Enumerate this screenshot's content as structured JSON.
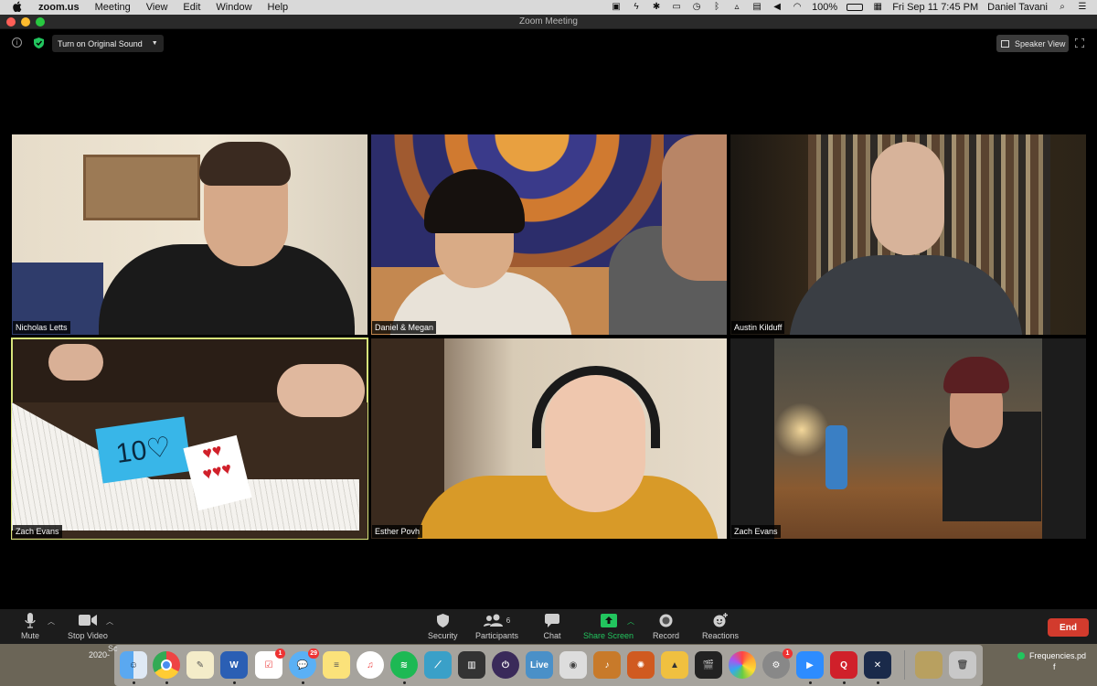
{
  "menubar": {
    "apple": "",
    "app_name": "zoom.us",
    "menus": [
      "Meeting",
      "View",
      "Edit",
      "Window",
      "Help"
    ],
    "battery": "100%",
    "datetime": "Fri Sep 11  7:45 PM",
    "user": "Daniel Tavani"
  },
  "window": {
    "title": "Zoom Meeting"
  },
  "top_controls": {
    "original_sound": "Turn on Original Sound",
    "speaker_view": "Speaker View"
  },
  "participants": [
    {
      "name": "Nicholas Letts"
    },
    {
      "name": "Daniel & Megan"
    },
    {
      "name": "Austin Kilduff"
    },
    {
      "name": "Zach Evans"
    },
    {
      "name": "Esther Povh"
    },
    {
      "name": "Zach Evans"
    }
  ],
  "toolbar": {
    "mute": "Mute",
    "stop_video": "Stop Video",
    "security": "Security",
    "participants": "Participants",
    "participants_count": "6",
    "chat": "Chat",
    "share_screen": "Share Screen",
    "record": "Record",
    "reactions": "Reactions",
    "end": "End"
  },
  "dock": {
    "calendar_badge": "1",
    "messages_badge": "29",
    "sysprefs_badge": "1",
    "live_label": "Live",
    "word_label": "W",
    "quicken_label": "Q"
  },
  "desktop": {
    "file_name": "Frequencies.pd",
    "file_name_line2": "f",
    "left_file_partial": "Sc",
    "left_file_date": "2020-"
  },
  "colors": {
    "share_green": "#22c55e",
    "end_red": "#d23b2d",
    "active_speaker": "#d7e37a"
  }
}
